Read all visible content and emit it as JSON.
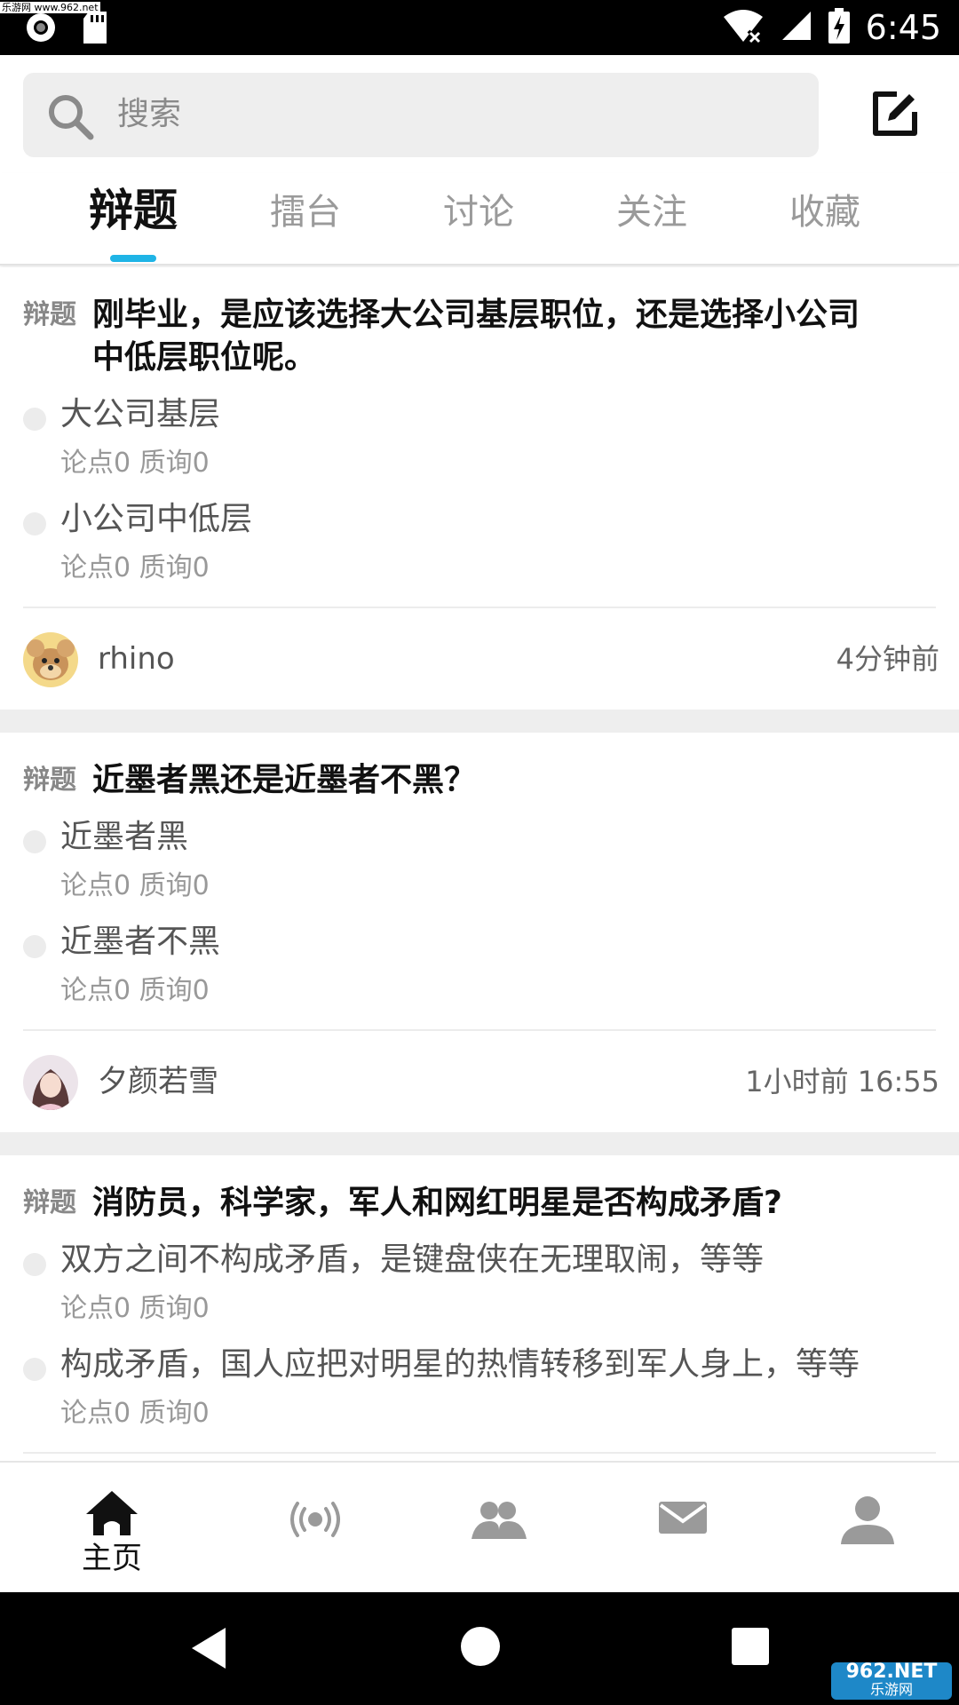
{
  "status_bar": {
    "watermark": "乐游网 www.962.net",
    "time": "6:45",
    "icons": [
      "camera-icon",
      "sd-card-icon",
      "wifi-off-icon",
      "signal-icon",
      "battery-charging-icon"
    ]
  },
  "search": {
    "placeholder": "搜索",
    "icon": "search-icon",
    "compose_icon": "edit-icon"
  },
  "tabs": [
    {
      "label": "辩题",
      "active": true
    },
    {
      "label": "擂台",
      "active": false
    },
    {
      "label": "讨论",
      "active": false
    },
    {
      "label": "关注",
      "active": false
    },
    {
      "label": "收藏",
      "active": false
    }
  ],
  "accent_color": "#1fb4e6",
  "feed": [
    {
      "tag": "辩题",
      "title": "刚毕业，是应该选择大公司基层职位，还是选择小公司中低层职位呢。",
      "options": [
        {
          "text": "大公司基层",
          "stats": "论点0 质询0"
        },
        {
          "text": "小公司中低层",
          "stats": "论点0 质询0"
        }
      ],
      "user": "rhino",
      "time": "4分钟前"
    },
    {
      "tag": "辩题",
      "title": "近墨者黑还是近墨者不黑？",
      "options": [
        {
          "text": "近墨者黑",
          "stats": "论点0 质询0"
        },
        {
          "text": "近墨者不黑",
          "stats": "论点0 质询0"
        }
      ],
      "user": "夕颜若雪",
      "time": "1小时前 16:55"
    },
    {
      "tag": "辩题",
      "title": "消防员，科学家，军人和网红明星是否构成矛盾?",
      "options": [
        {
          "text": "双方之间不构成矛盾，是键盘侠在无理取闹，等等",
          "stats": "论点0 质询0"
        },
        {
          "text": "构成矛盾，国人应把对明星的热情转移到军人身上，等等",
          "stats": "论点0 质询0"
        }
      ]
    }
  ],
  "bottom_nav": [
    {
      "icon": "home-icon",
      "label": "主页",
      "active": true
    },
    {
      "icon": "broadcast-icon",
      "label": "",
      "active": false
    },
    {
      "icon": "group-icon",
      "label": "",
      "active": false
    },
    {
      "icon": "mail-icon",
      "label": "",
      "active": false
    },
    {
      "icon": "profile-icon",
      "label": "",
      "active": false
    }
  ],
  "system_nav": [
    "back-icon",
    "home-circle-icon",
    "recents-icon"
  ],
  "corner_watermark": {
    "line1": "962.NET",
    "line2": "乐游网"
  }
}
